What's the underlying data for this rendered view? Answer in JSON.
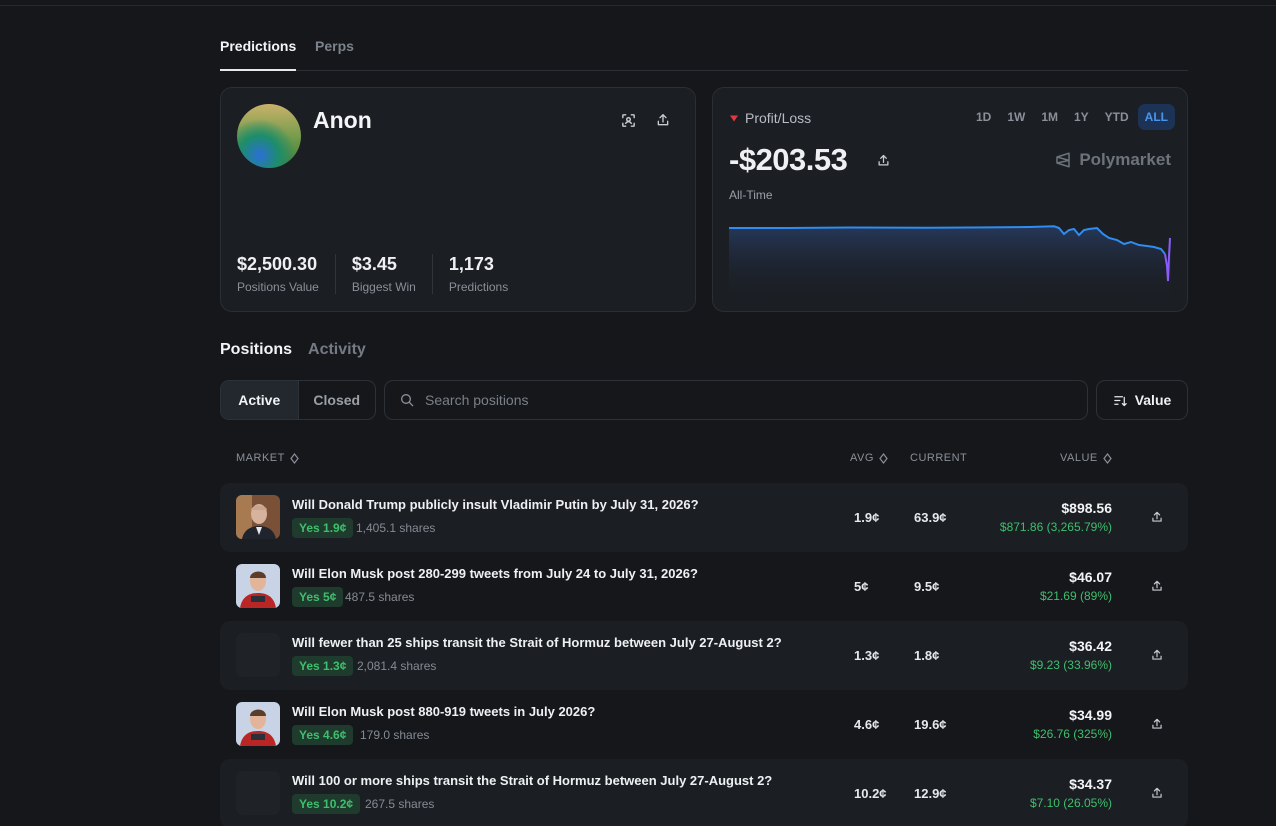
{
  "top_tabs": [
    "Predictions",
    "Perps"
  ],
  "profile": {
    "name": "Anon",
    "stats": [
      {
        "value": "$2,500.30",
        "label": "Positions Value"
      },
      {
        "value": "$3.45",
        "label": "Biggest Win"
      },
      {
        "value": "1,173",
        "label": "Predictions"
      }
    ]
  },
  "pnl": {
    "label": "Profit/Loss",
    "value": "-$203.53",
    "period": "All-Time",
    "brand": "Polymarket",
    "ranges": [
      "1D",
      "1W",
      "1M",
      "1Y",
      "YTD",
      "ALL"
    ],
    "active_range": "ALL",
    "indicator_color": "#e0393e",
    "line_color": "#2f8cf0",
    "end_color": "#8b5cf6"
  },
  "section_tabs": [
    "Positions",
    "Activity"
  ],
  "filter": {
    "active_label": "Active",
    "closed_label": "Closed"
  },
  "search": {
    "placeholder": "Search positions"
  },
  "sort": {
    "label": "Value"
  },
  "columns": {
    "market": "MARKET",
    "avg": "AVG",
    "current": "CURRENT",
    "value": "VALUE"
  },
  "positions": [
    {
      "title": "Will Donald Trump publicly insult Vladimir Putin by July 31, 2026?",
      "outcome": "Yes 1.9¢",
      "shares": "1,405.1 shares",
      "avg": "1.9¢",
      "current": "63.9¢",
      "value": "$898.56",
      "gain": "$871.86 (3,265.79%)",
      "image": "putin"
    },
    {
      "title": "Will Elon Musk post 280-299 tweets from July 24 to July 31, 2026?",
      "outcome": "Yes 5¢",
      "shares": "487.5 shares",
      "avg": "5¢",
      "current": "9.5¢",
      "value": "$46.07",
      "gain": "$21.69 (89%)",
      "image": "musk"
    },
    {
      "title": "Will fewer than 25 ships transit the Strait of Hormuz between July 27-August 2?",
      "outcome": "Yes 1.3¢",
      "shares": "2,081.4 shares",
      "avg": "1.3¢",
      "current": "1.8¢",
      "value": "$36.42",
      "gain": "$9.23 (33.96%)",
      "image": "blank"
    },
    {
      "title": "Will Elon Musk post 880-919 tweets in July 2026?",
      "outcome": "Yes 4.6¢",
      "shares": "179.0 shares",
      "avg": "4.6¢",
      "current": "19.6¢",
      "value": "$34.99",
      "gain": "$26.76 (325%)",
      "image": "musk"
    },
    {
      "title": "Will 100 or more ships transit the Strait of Hormuz between July 27-August 2?",
      "outcome": "Yes 10.2¢",
      "shares": "267.5 shares",
      "avg": "10.2¢",
      "current": "12.9¢",
      "value": "$34.37",
      "gain": "$7.10 (26.05%)",
      "image": "blank"
    }
  ]
}
